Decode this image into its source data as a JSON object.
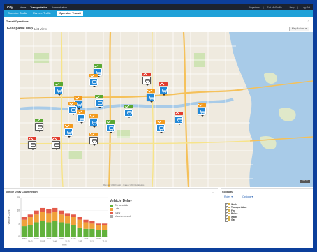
{
  "app": {
    "brand": "City",
    "nav": [
      {
        "label": "Home",
        "active": false
      },
      {
        "label": "Transportation",
        "active": true
      },
      {
        "label": "Administration",
        "active": false
      }
    ],
    "utility": [
      "Appadmin",
      "Edit My Profile",
      "Help",
      "Log Out"
    ]
  },
  "subtabs": [
    {
      "label": "Operator: Traffic",
      "active": false
    },
    {
      "label": "Planner: Traffic",
      "active": false
    },
    {
      "label": "Operator: Transit",
      "active": true
    }
  ],
  "transit_panel": {
    "title": "Transit Operations",
    "map_title": "Geospatial Map",
    "list_view_label": "List View",
    "map_actions_label": "Map Actions"
  },
  "map": {
    "footer": "Map data ©2013 Google · Imagery ©2013 TerraMetrics",
    "scale": "0.2 mi",
    "markers": [
      {
        "status": "on-schedule",
        "tag_color": "#5aa832",
        "pin_color": "#2288d8"
      },
      {
        "status": "on-schedule",
        "tag_color": "#5aa832",
        "pin_color": "#2288d8"
      },
      {
        "status": "late",
        "tag_color": "#f39a1c",
        "pin_color": "#2288d8"
      },
      {
        "status": "early",
        "tag_color": "#e23b2e",
        "pin_color": "#ffffff"
      },
      {
        "status": "late",
        "tag_color": "#f39a1c",
        "pin_color": "#2288d8"
      },
      {
        "status": "late",
        "tag_color": "#f39a1c",
        "pin_color": "#2288d8"
      },
      {
        "status": "on-schedule",
        "tag_color": "#5aa832",
        "pin_color": "#2288d8"
      },
      {
        "status": "late",
        "tag_color": "#f39a1c",
        "pin_color": "#2288d8"
      },
      {
        "status": "early",
        "tag_color": "#e23b2e",
        "pin_color": "#2288d8"
      },
      {
        "status": "late",
        "tag_color": "#f39a1c",
        "pin_color": "#2288d8"
      },
      {
        "status": "on-schedule",
        "tag_color": "#5aa832",
        "pin_color": "#2288d8"
      },
      {
        "status": "late",
        "tag_color": "#f39a1c",
        "pin_color": "#2288d8"
      },
      {
        "status": "on-schedule",
        "tag_color": "#5aa832",
        "pin_color": "#ffffff"
      },
      {
        "status": "late",
        "tag_color": "#f39a1c",
        "pin_color": "#2288d8"
      },
      {
        "status": "early",
        "tag_color": "#e23b2e",
        "pin_color": "#2288d8"
      },
      {
        "status": "late",
        "tag_color": "#f39a1c",
        "pin_color": "#2288d8"
      },
      {
        "status": "late",
        "tag_color": "#f39a1c",
        "pin_color": "#2288d8"
      },
      {
        "status": "on-schedule",
        "tag_color": "#5aa832",
        "pin_color": "#2288d8"
      },
      {
        "status": "early",
        "tag_color": "#e23b2e",
        "pin_color": "#ffffff"
      },
      {
        "status": "late",
        "tag_color": "#f39a1c",
        "pin_color": "#ffffff"
      },
      {
        "status": "early",
        "tag_color": "#e23b2e",
        "pin_color": "#ffffff"
      }
    ]
  },
  "delay_panel": {
    "title": "Vehicle Delay Count Report"
  },
  "chart_data": {
    "type": "bar",
    "stacked": true,
    "title": "Vehicle Delay",
    "xlabel": "Time",
    "ylabel": "Vehicle Count",
    "ylim": [
      0,
      15
    ],
    "yticks": [
      0,
      5,
      10,
      15
    ],
    "categories": [
      "09:30",
      "09:45",
      "10:00",
      "10:15",
      "10:30",
      "10:45",
      "11:00",
      "11:15",
      "11:30",
      "11:45",
      "12:00",
      "12:15",
      "12:30",
      "12:45"
    ],
    "xtick_labels_top": [
      "09:30",
      "10:00",
      "10:30",
      "11:00",
      "11:30",
      "12:00",
      "12:30"
    ],
    "xtick_labels_bottom": [
      "09:45",
      "10:15",
      "10:45",
      "11:15",
      "11:45",
      "12:15",
      "12:45"
    ],
    "series": [
      {
        "name": "On schedule",
        "color": "#62b23c",
        "values": [
          4.0,
          4.5,
          5.5,
          6.0,
          5.5,
          6.0,
          5.5,
          5.0,
          4.5,
          3.5,
          3.0,
          3.0,
          2.5,
          2.5
        ]
      },
      {
        "name": "Late",
        "color": "#f0a13a",
        "values": [
          2.5,
          3.0,
          3.0,
          3.5,
          3.5,
          3.5,
          3.0,
          3.0,
          3.0,
          3.0,
          2.5,
          2.0,
          2.0,
          2.0
        ]
      },
      {
        "name": "Early",
        "color": "#e35a4a",
        "values": [
          1.0,
          1.0,
          1.5,
          1.5,
          1.5,
          1.5,
          1.5,
          1.0,
          1.0,
          1.0,
          1.0,
          1.0,
          0.5,
          0.5
        ]
      },
      {
        "name": "Undetermined",
        "color": "#a9a9a9",
        "values": [
          0,
          0,
          0,
          0,
          0,
          0,
          0,
          0,
          0,
          0,
          0,
          0,
          0,
          0
        ]
      }
    ],
    "legend_position": "right"
  },
  "contacts_panel": {
    "title": "Contacts",
    "filter_roles": "Roles",
    "filter_options": "Options",
    "tree": [
      "Work",
      "Transportation",
      "Fire",
      "Police",
      "Water",
      "Gas"
    ]
  }
}
